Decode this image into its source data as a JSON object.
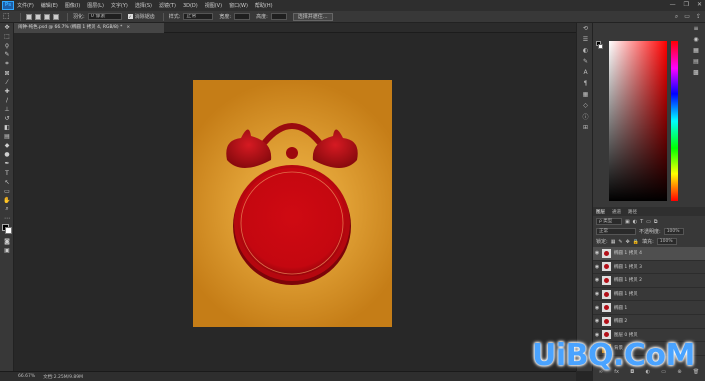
{
  "app": {
    "logo_text": "Ps"
  },
  "menubar": {
    "items": [
      "文件(F)",
      "编辑(E)",
      "图像(I)",
      "图层(L)",
      "文字(Y)",
      "选择(S)",
      "滤镜(T)",
      "3D(D)",
      "视图(V)",
      "窗口(W)",
      "帮助(H)"
    ],
    "window_controls": [
      "—",
      "❐",
      "✕"
    ]
  },
  "optionsbar": {
    "feather_label": "羽化:",
    "feather_value": "0 像素",
    "style_label": "样式:",
    "style_value": "正常",
    "antialias_label": "消除锯齿",
    "width_label": "宽度:",
    "height_label": "高度:",
    "refine_button": "选择并遮住...",
    "right_icons": [
      "search-icon",
      "workspace-icon",
      "share-icon"
    ]
  },
  "document": {
    "tab_title": "闹钟-纯色.psd @ 66.7% (椭圆 1 拷贝 4, RGB/8) *",
    "close_glyph": "×"
  },
  "statusbar": {
    "zoom": "66.67%",
    "doc_info": "文档:2.25M/9.89M"
  },
  "layers_panel": {
    "tabs": [
      "图层",
      "通道",
      "路径"
    ],
    "kind_label": "ρ 类型",
    "blend_mode": "正常",
    "opacity_label": "不透明度:",
    "opacity_value": "100%",
    "lock_label": "锁定:",
    "fill_label": "填充:",
    "fill_value": "100%",
    "layers": [
      {
        "name": "椭圆 1 拷贝 4",
        "selected": true
      },
      {
        "name": "椭圆 1 拷贝 3",
        "selected": false
      },
      {
        "name": "椭圆 1 拷贝 2",
        "selected": false
      },
      {
        "name": "椭圆 1 拷贝",
        "selected": false
      },
      {
        "name": "椭圆 1",
        "selected": false
      },
      {
        "name": "椭圆 2",
        "selected": false
      },
      {
        "name": "图层 0 拷贝",
        "selected": false
      },
      {
        "name": "背景",
        "selected": false
      }
    ],
    "footer_icons": [
      "link-icon",
      "fx-icon",
      "mask-icon",
      "adjustment-icon",
      "folder-icon",
      "new-layer-icon",
      "trash-icon"
    ]
  },
  "watermark": {
    "text": "UiBQ.CoM"
  },
  "colors": {
    "canvas_bg": "#c98a1f",
    "clock_red": "#c90a12",
    "accent_blue": "#31a8ff"
  }
}
